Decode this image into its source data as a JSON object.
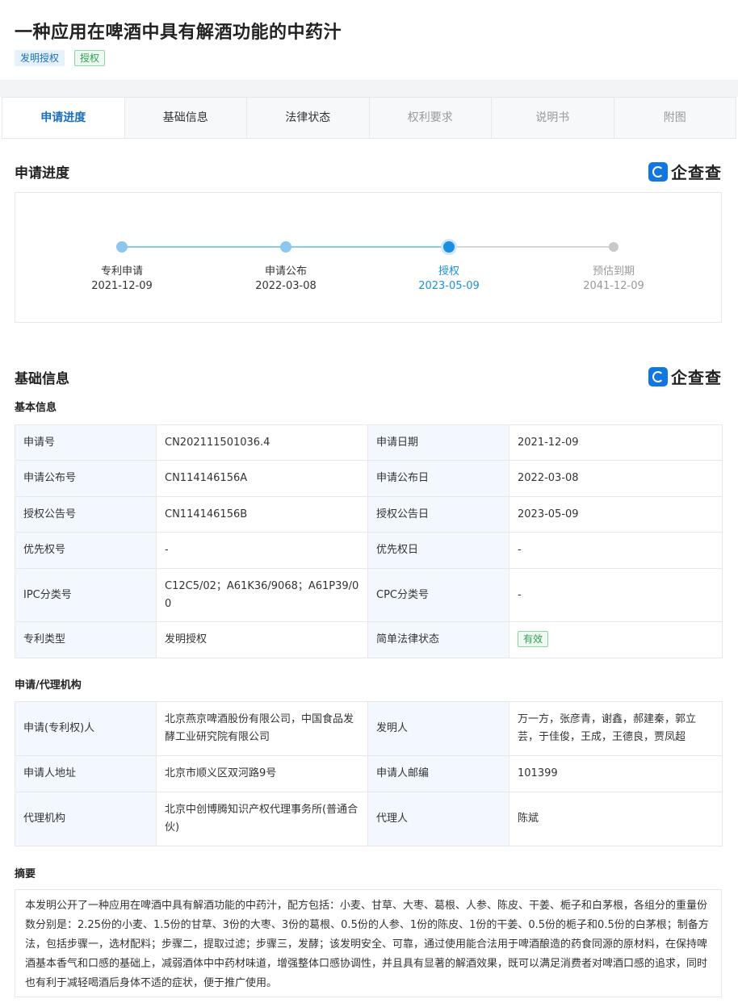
{
  "title": "一种应用在啤酒中具有解酒功能的中药汁",
  "tags": [
    "发明授权",
    "授权"
  ],
  "tabs": [
    "申请进度",
    "基础信息",
    "法律状态",
    "权利要求",
    "说明书",
    "附图"
  ],
  "progress": {
    "title": "申请进度",
    "logo": "企查查",
    "steps": [
      {
        "label": "专利申请",
        "date": "2021-12-09"
      },
      {
        "label": "申请公布",
        "date": "2022-03-08"
      },
      {
        "label": "授权",
        "date": "2023-05-09"
      },
      {
        "label": "预估到期",
        "date": "2041-12-09"
      }
    ],
    "colors": {
      "done": "#8cc7ef",
      "current": "#1a8fe0",
      "future": "#c8c8c8",
      "current_text": "#1a8fe0",
      "future_text": "#999999"
    }
  },
  "basic": {
    "title": "基础信息",
    "logo": "企查查",
    "subtitle": "基本信息",
    "rows": [
      [
        "申请号",
        "CN202111501036.4",
        "申请日期",
        "2021-12-09"
      ],
      [
        "申请公布号",
        "CN114146156A",
        "申请公布日",
        "2022-03-08"
      ],
      [
        "授权公告号",
        "CN114146156B",
        "授权公告日",
        "2023-05-09"
      ],
      [
        "优先权号",
        "-",
        "优先权日",
        "-"
      ],
      [
        "IPC分类号",
        "C12C5/02；A61K36/9068；A61P39/00",
        "CPC分类号",
        "-"
      ],
      [
        "专利类型",
        "发明授权",
        "简单法律状态",
        "有效"
      ]
    ]
  },
  "agency": {
    "subtitle": "申请/代理机构",
    "rows": [
      [
        "申请(专利权)人",
        "北京燕京啤酒股份有限公司，中国食品发酵工业研究院有限公司",
        "发明人",
        "万一方，张彦青，谢鑫，郝建秦，郭立芸，于佳俊，王成，王德良，贾凤超"
      ],
      [
        "申请人地址",
        "北京市顺义区双河路9号",
        "申请人邮编",
        "101399"
      ],
      [
        "代理机构",
        "北京中创博腾知识产权代理事务所(普通合伙)",
        "代理人",
        "陈斌"
      ]
    ]
  },
  "abstract": {
    "subtitle": "摘要",
    "text": "本发明公开了一种应用在啤酒中具有解酒功能的中药汁，配方包括：小麦、甘草、大枣、葛根、人参、陈皮、干姜、栀子和白茅根，各组分的重量份数分别是：2.25份的小麦、1.5份的甘草、3份的大枣、3份的葛根、0.5份的人参、1份的陈皮、1份的干姜、0.5份的栀子和0.5份的白茅根；制备方法，包括步骤一，选材配料；步骤二，提取过滤；步骤三，发酵；该发明安全、可靠，通过使用能合法用于啤酒酿造的药食同源的原材料，在保持啤酒基本香气和口感的基础上，减弱酒体中中药材味道，增强整体口感协调性，并且具有显著的解酒效果，既可以满足消费者对啤酒口感的追求，同时也有利于减轻喝酒后身体不适的症状，便于推广使用。"
  }
}
